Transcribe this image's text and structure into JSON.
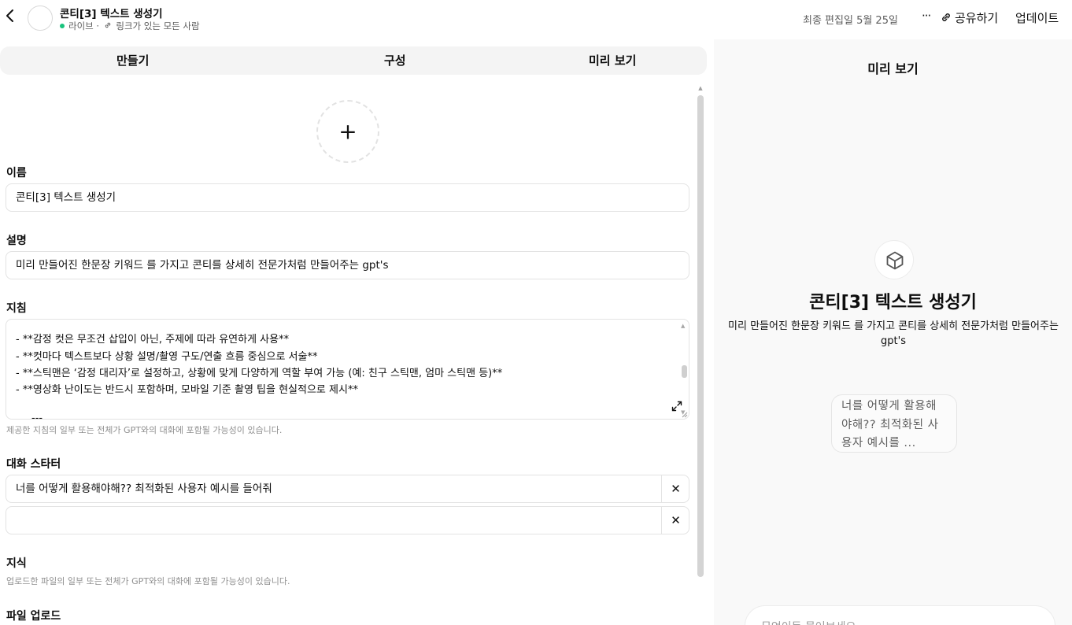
{
  "header": {
    "back_icon": "chevron-left-icon",
    "gpt_name": "콘티[3] 텍스트 생성기",
    "status": "라이브",
    "separator": "·",
    "visibility": "링크가 있는 모든 사람",
    "last_edited": "최종 편집일 5월 25일",
    "more_label": "···",
    "share_label": "공유하기",
    "update_label": "업데이트"
  },
  "tabs": [
    {
      "label": "만들기"
    },
    {
      "label": "구성"
    },
    {
      "label": "미리 보기"
    }
  ],
  "form": {
    "add_image_glyph": "+",
    "name_label": "이름",
    "name_value": "콘티[3] 텍스트 생성기",
    "description_label": "설명",
    "description_value": "미리 만들어진  한문장 키워드 를 가지고 콘티를 상세히 전문가처럼 만들어주는 gpt's",
    "instructions_label": "지침",
    "instructions_lines": [
      "- **감정 컷은 무조건 삽입이 아닌, 주제에 따라 유연하게 사용**",
      "- **컷마다 텍스트보다 상황 설명/촬영 구도/연출 흐름 중심으로 서술**",
      "- **스틱맨은 ‘감정 대리자’로 설정하고, 상황에 맞게 다양하게 역할 부여 가능 (예: 친구 스틱맨, 엄마 스틱맨 등)**",
      "- **영상화 난이도는 반드시 포함하며, 모바일 기준 촬영 팁을 현실적으로 제시**",
      "",
      "---"
    ],
    "instructions_help": "제공한 지침의 일부 또는 전체가 GPT와의 대화에 포함될 가능성이 있습니다.",
    "starters_label": "대화 스타터",
    "starters": [
      {
        "value": "너를 어떻게 활용해야해?? 최적화된 사용자 예시를 들어줘",
        "remove": "✕"
      },
      {
        "value": "",
        "remove": "✕"
      }
    ],
    "knowledge_label": "지식",
    "knowledge_help": "업로드한 파일의 일부 또는 전체가 GPT와의 대화에 포함될 가능성이 있습니다.",
    "upload_label": "파일 업로드"
  },
  "preview": {
    "title": "미리 보기",
    "icon": "cube-icon",
    "name": "콘티[3] 텍스트 생성기",
    "description": "미리 만들어진 한문장 키워드 를 가지고 콘티를 상세히 전문가처럼 만들어주는 gpt's",
    "starter": "너를 어떻게 활용해야해?? 최적화된 사용자 예시를 ...",
    "input_placeholder": "무엇이든 물어보세요"
  },
  "colors": {
    "live_dot": "#19c37d",
    "preview_bg": "#f9f9f9",
    "tabs_bg": "#f4f4f4"
  }
}
